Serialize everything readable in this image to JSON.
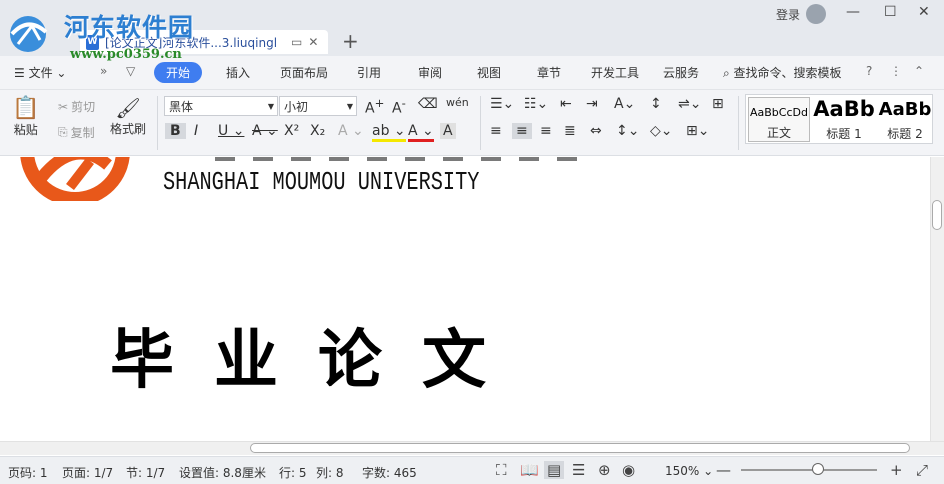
{
  "window": {
    "doc_tab_title": "[论文正文]河东软件...3.liuqingl",
    "login_label": "登录"
  },
  "watermark": {
    "name": "河东软件园",
    "url": "www.pc0359.cn"
  },
  "menu": {
    "file": "文件",
    "items": [
      "开始",
      "插入",
      "页面布局",
      "引用",
      "审阅",
      "视图",
      "章节",
      "开发工具",
      "云服务"
    ],
    "search": "查找命令、搜索模板"
  },
  "toolbar": {
    "paste": "粘贴",
    "cut": "剪切",
    "copy": "复制",
    "format_painter": "格式刷",
    "font_name": "黑体",
    "font_size": "小初",
    "styles": [
      {
        "sample": "AaBbCcDd",
        "label": "正文"
      },
      {
        "sample": "AaBb",
        "label": "标题 1"
      },
      {
        "sample": "AaBb",
        "label": "标题 2"
      }
    ]
  },
  "document": {
    "university_en": "SHANGHAI MOUMOU UNIVERSITY",
    "heading": "毕业论文"
  },
  "status": {
    "page_code": "页码: 1",
    "pages": "页面: 1/7",
    "section": "节: 1/7",
    "position": "设置值: 8.8厘米",
    "row": "行: 5",
    "col": "列: 8",
    "word_count": "字数: 465",
    "zoom": "150%"
  },
  "colors": {
    "accent": "#3f7df0",
    "emblem": "#e8581a"
  }
}
